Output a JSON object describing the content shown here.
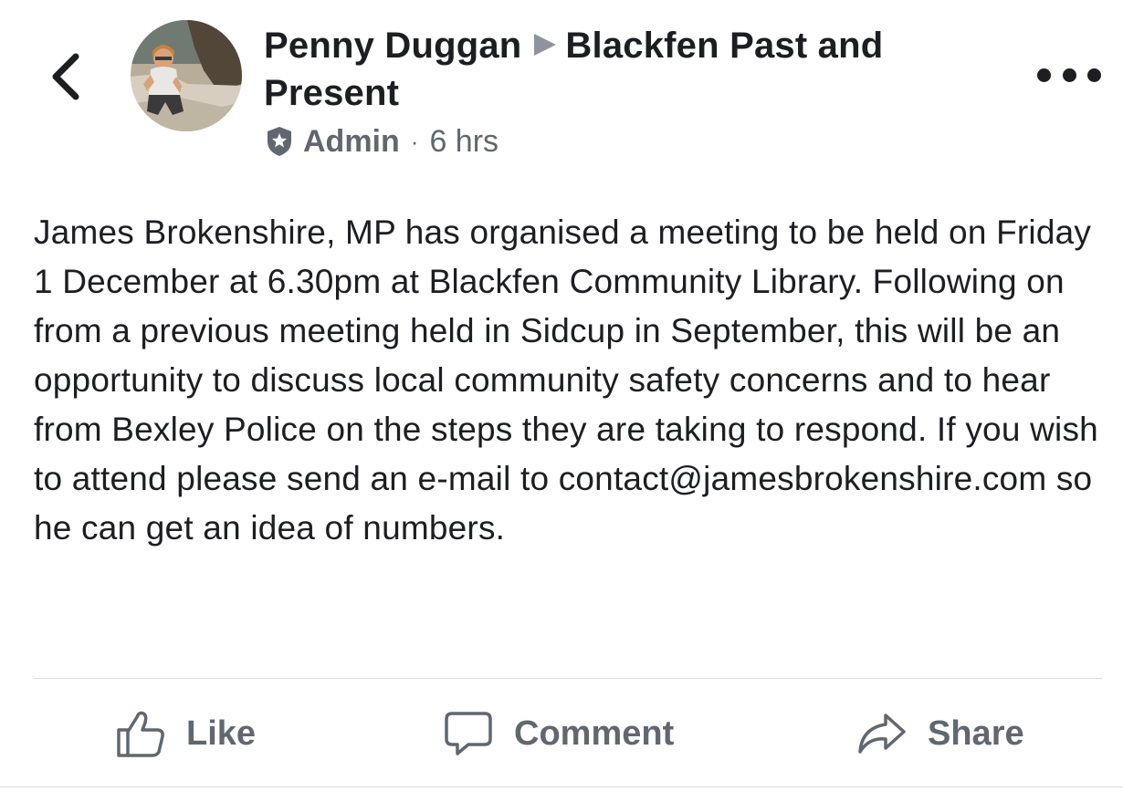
{
  "header": {
    "back_icon": "chevron-left-icon",
    "author": "Penny Duggan",
    "group": "Blackfen Past and Present",
    "role": "Admin",
    "separator": "·",
    "time": "6 hrs",
    "more_icon": "more-horizontal-icon"
  },
  "post": {
    "text": "James Brokenshire, MP has organised a meeting to be held on Friday 1 December at 6.30pm at Blackfen Community Library. Following on from a previous meeting held in Sidcup in September, this will be an opportunity to discuss local community safety concerns and to hear from Bexley Police on the steps they are taking to respond. If you wish to attend please send an e-mail to contact@jamesbrokenshire.com so he can get an idea of numbers."
  },
  "actions": {
    "like_label": "Like",
    "comment_label": "Comment",
    "share_label": "Share"
  },
  "colors": {
    "text": "#1c1e21",
    "secondary": "#606770",
    "divider": "#dadde1"
  }
}
